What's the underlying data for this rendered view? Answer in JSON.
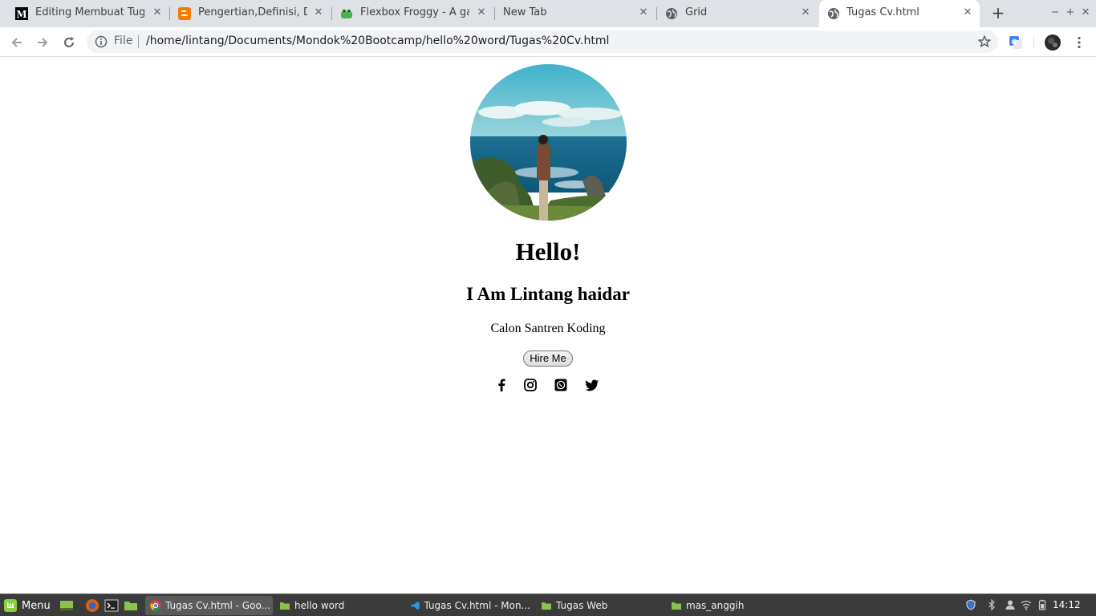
{
  "browser": {
    "tabs": [
      {
        "title": "Editing Membuat Tugas C",
        "icon": "medium-icon"
      },
      {
        "title": "Pengertian,Definisi, Dan",
        "icon": "blogger-icon"
      },
      {
        "title": "Flexbox Froggy - A game",
        "icon": "froggy-icon"
      },
      {
        "title": "New Tab",
        "icon": ""
      },
      {
        "title": "Grid",
        "icon": "globe-icon"
      },
      {
        "title": "Tugas Cv.html",
        "icon": "globe-icon"
      }
    ],
    "address": {
      "scheme": "File",
      "url": "/home/lintang/Documents/Mondok%20Bootcamp/hello%20word/Tugas%20Cv.html"
    }
  },
  "page": {
    "greeting": "Hello!",
    "name": "I Am Lintang haidar",
    "tagline": "Calon Santren Koding",
    "hire_button": "Hire Me",
    "social": [
      "facebook-icon",
      "instagram-icon",
      "whatsapp-icon",
      "twitter-icon"
    ]
  },
  "taskbar": {
    "menu_label": "Menu",
    "tasks": [
      {
        "label": "Tugas Cv.html - Goo...",
        "icon": "chrome-icon",
        "active": true
      },
      {
        "label": "hello word",
        "icon": "folder-icon",
        "active": false
      },
      {
        "label": "Tugas Cv.html - Mon...",
        "icon": "vscode-icon",
        "active": false
      },
      {
        "label": "Tugas Web",
        "icon": "folder-icon",
        "active": false
      },
      {
        "label": "mas_anggih",
        "icon": "folder-icon",
        "active": false
      }
    ],
    "clock": "14:12"
  },
  "colors": {
    "tabstrip": "#dee1e6",
    "taskbar": "#3b3b3b",
    "mint_green": "#87cf3e",
    "folder_green": "#8bc34a"
  }
}
